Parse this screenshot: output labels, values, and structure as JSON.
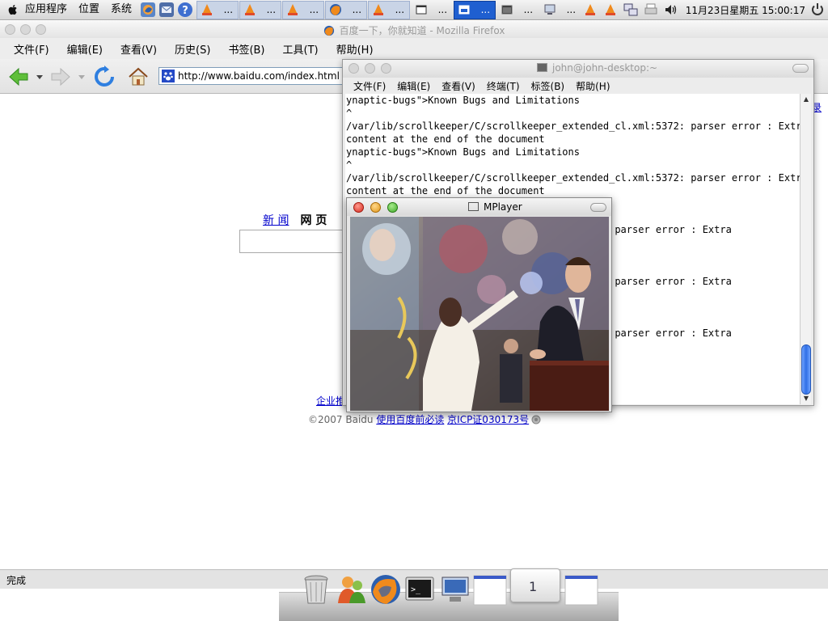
{
  "top_panel": {
    "menus": [
      "应用程序",
      "位置",
      "系统"
    ],
    "tasks": [
      {
        "icon": "vlc-icon",
        "label": "..."
      },
      {
        "icon": "vlc-icon",
        "label": "..."
      },
      {
        "icon": "vlc-icon",
        "label": "..."
      },
      {
        "icon": "firefox-icon",
        "label": "..."
      },
      {
        "icon": "vlc-icon",
        "label": "..."
      },
      {
        "icon": "window-icon",
        "label": "..."
      },
      {
        "icon": "window-icon",
        "label": "..."
      },
      {
        "icon": "terminal-icon",
        "label": "..."
      },
      {
        "icon": "network-icon",
        "label": "..."
      }
    ],
    "clock": "11月23日星期五 15:00:17"
  },
  "firefox": {
    "title": "百度一下，你就知道 - Mozilla Firefox",
    "menus": [
      "文件(F)",
      "编辑(E)",
      "查看(V)",
      "历史(S)",
      "书签(B)",
      "工具(T)",
      "帮助(H)"
    ],
    "url": "http://www.baidu.com/index.html",
    "status": "完成"
  },
  "baidu": {
    "tab_news": "新 闻",
    "tab_web": "网 页",
    "right_link": "录",
    "footer_link": "企业推",
    "copyright_prefix": "©2007 Baidu ",
    "must_read": "使用百度前必读",
    "icp": "京ICP证030173号"
  },
  "terminal": {
    "title": "john@john-desktop:~",
    "menus": [
      "文件(F)",
      "编辑(E)",
      "查看(V)",
      "终端(T)",
      "标签(B)",
      "帮助(H)"
    ],
    "lines": [
      "ynaptic-bugs\">Known Bugs and Limitations",
      "^",
      "/var/lib/scrollkeeper/C/scrollkeeper_extended_cl.xml:5372: parser error : Extra",
      "content at the end of the document",
      "ynaptic-bugs\">Known Bugs and Limitations",
      "^",
      "/var/lib/scrollkeeper/C/scrollkeeper_extended_cl.xml:5372: parser error : Extra",
      "content at the end of the document",
      "",
      "",
      "                                  l.xml:5372: parser error : Extra",
      "",
      "",
      "",
      "                                  l.xml:5372: parser error : Extra",
      "",
      "",
      "",
      "                                  l.xml:5372: parser error : Extra",
      "",
      "",
      "",
      "",
      ""
    ]
  },
  "mplayer": {
    "title": "MPlayer"
  },
  "dock": {
    "items": [
      "trash-icon",
      "people-icon",
      "firefox-icon",
      "terminal-icon",
      "network-icon",
      "window-thumbnail-icon",
      "workspace-switcher-icon",
      "window-thumbnail-icon"
    ],
    "workspace_number": "1"
  },
  "colors": {
    "link": "#0000cc",
    "active_task": "#1f5fd0",
    "scroll_thumb": "#2f6fe6"
  }
}
